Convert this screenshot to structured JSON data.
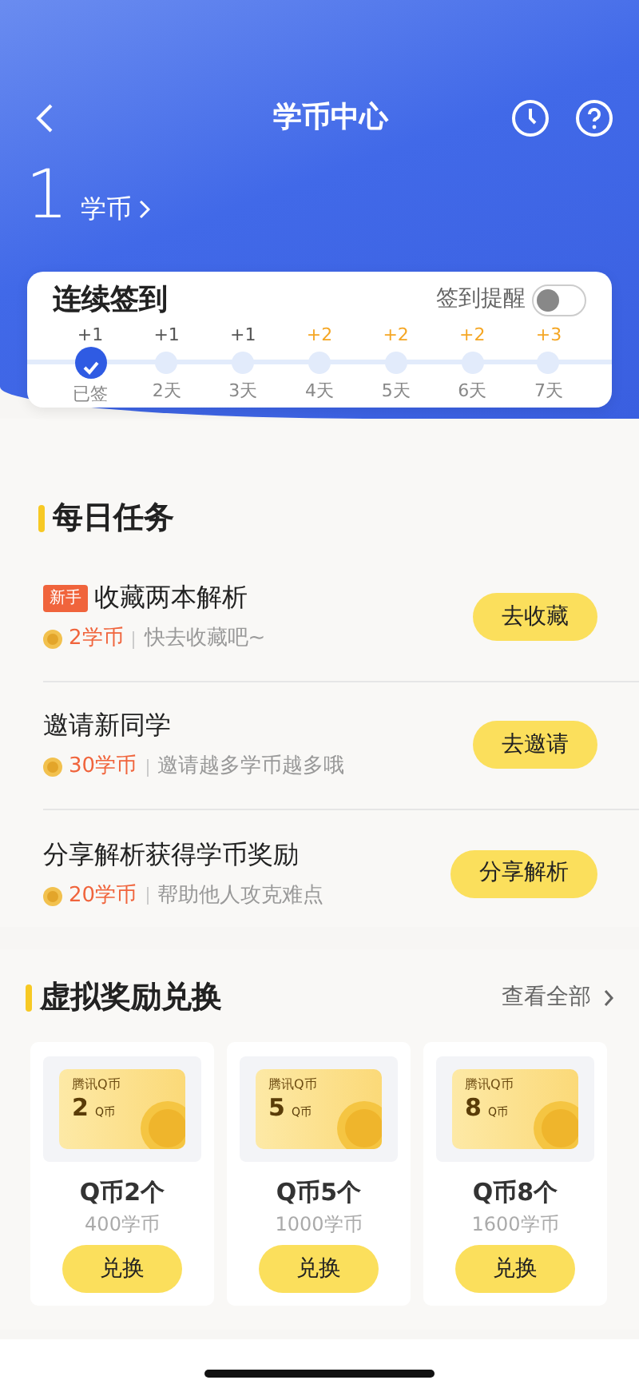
{
  "header": {
    "title": "学币中心",
    "balance": "1",
    "balance_unit": "学币"
  },
  "checkin": {
    "title": "连续签到",
    "reminder_label": "签到提醒",
    "reminder_on": false,
    "days": [
      {
        "bonus": "+1",
        "label": "已签",
        "checked": true,
        "color": "#555555"
      },
      {
        "bonus": "+1",
        "label": "2天",
        "checked": false,
        "color": "#555555"
      },
      {
        "bonus": "+1",
        "label": "3天",
        "checked": false,
        "color": "#555555"
      },
      {
        "bonus": "+2",
        "label": "4天",
        "checked": false,
        "color": "#f5a623"
      },
      {
        "bonus": "+2",
        "label": "5天",
        "checked": false,
        "color": "#f5a623"
      },
      {
        "bonus": "+2",
        "label": "6天",
        "checked": false,
        "color": "#f5a623"
      },
      {
        "bonus": "+3",
        "label": "7天",
        "checked": false,
        "color": "#f5a623"
      }
    ]
  },
  "daily_tasks": {
    "title": "每日任务",
    "tasks": [
      {
        "tag": "新手",
        "title": "收藏两本解析",
        "reward": "2学币",
        "note": "快去收藏吧~",
        "button": "去收藏"
      },
      {
        "title": "邀请新同学",
        "reward": "30学币",
        "note": "邀请越多学币越多哦",
        "button": "去邀请"
      },
      {
        "title": "分享解析获得学币奖励",
        "reward": "20学币",
        "note": "帮助他人攻克难点",
        "button": "分享解析"
      }
    ]
  },
  "rewards": {
    "title": "虚拟奖励兑换",
    "view_all": "查看全部",
    "items": [
      {
        "card_brand": "腾讯Q币",
        "card_amount": "2",
        "card_unit": "Q币",
        "name": "Q币2个",
        "price": "400学币",
        "button": "兑换"
      },
      {
        "card_brand": "腾讯Q币",
        "card_amount": "5",
        "card_unit": "Q币",
        "name": "Q币5个",
        "price": "1000学币",
        "button": "兑换"
      },
      {
        "card_brand": "腾讯Q币",
        "card_amount": "8",
        "card_unit": "Q币",
        "name": "Q币8个",
        "price": "1600学币",
        "button": "兑换"
      }
    ]
  }
}
